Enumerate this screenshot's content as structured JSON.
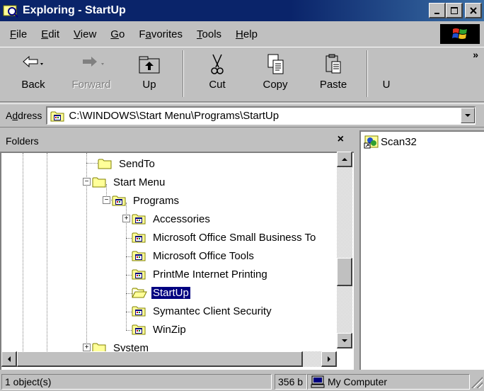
{
  "window": {
    "title": "Exploring - StartUp",
    "minimize": "_",
    "maximize": "□",
    "close": "✕"
  },
  "menu": {
    "items": [
      {
        "accel": "F",
        "rest": "ile"
      },
      {
        "accel": "E",
        "rest": "dit"
      },
      {
        "accel": "V",
        "rest": "iew"
      },
      {
        "accel": "G",
        "rest": "o"
      },
      {
        "pre": "F",
        "accel": "a",
        "rest": "vorites"
      },
      {
        "accel": "T",
        "rest": "ools"
      },
      {
        "accel": "H",
        "rest": "elp"
      }
    ]
  },
  "toolbar": {
    "back": "Back",
    "forward": "Forward",
    "up": "Up",
    "cut": "Cut",
    "copy": "Copy",
    "paste": "Paste",
    "partial": "U",
    "more": "»"
  },
  "address": {
    "label_pre": "A",
    "label_accel": "d",
    "label_rest": "dress",
    "value": "C:\\WINDOWS\\Start Menu\\Programs\\StartUp"
  },
  "folders": {
    "header": "Folders",
    "close": "×",
    "tree": [
      {
        "label": "SendTo",
        "selected": false
      },
      {
        "label": "Start Menu",
        "selected": false
      },
      {
        "label": "Programs",
        "selected": false
      },
      {
        "label": "Accessories",
        "selected": false
      },
      {
        "label": "Microsoft Office Small Business To",
        "selected": false
      },
      {
        "label": "Microsoft Office Tools",
        "selected": false
      },
      {
        "label": "PrintMe Internet Printing",
        "selected": false
      },
      {
        "label": "StartUp",
        "selected": true
      },
      {
        "label": "Symantec Client Security",
        "selected": false
      },
      {
        "label": "WinZip",
        "selected": false
      },
      {
        "label": "System",
        "selected": false
      }
    ]
  },
  "files": {
    "items": [
      {
        "label": "Scan32",
        "icon": "shortcut-icon"
      }
    ]
  },
  "status": {
    "objects": "1 object(s)",
    "size": "356 b",
    "zone": "My Computer"
  },
  "icons": {
    "folder_color": "#ffff99",
    "folder_outline": "#808000",
    "title_gradient_start": "#0a246a",
    "title_gradient_end": "#3a6ea5",
    "selection": "#000080"
  }
}
